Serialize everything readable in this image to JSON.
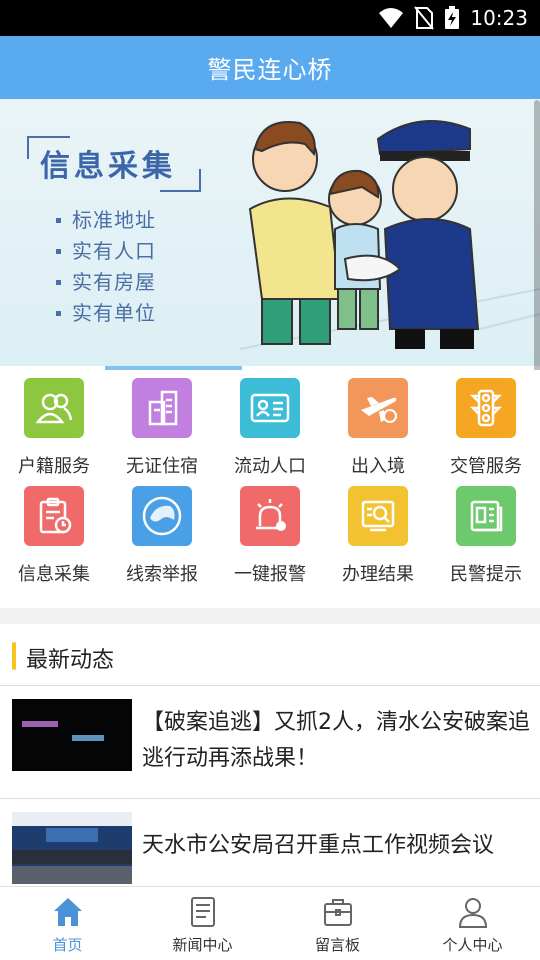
{
  "status_bar": {
    "time": "10:23",
    "icons": [
      "wifi-icon",
      "no-sim-icon",
      "battery-charging-icon"
    ]
  },
  "header": {
    "title": "警民连心桥",
    "color": "#5aaaf0"
  },
  "banner": {
    "title": "信息采集",
    "items": [
      "标准地址",
      "实有人口",
      "实有房屋",
      "实有单位"
    ]
  },
  "services": [
    {
      "label": "户籍服务",
      "icon": "household-icon",
      "color": "#8dc63f"
    },
    {
      "label": "无证住宿",
      "icon": "building-icon",
      "color": "#c17fe0"
    },
    {
      "label": "流动人口",
      "icon": "id-card-icon",
      "color": "#3dbcd8"
    },
    {
      "label": "出入境",
      "icon": "airplane-icon",
      "color": "#f39659"
    },
    {
      "label": "交管服务",
      "icon": "traffic-light-icon",
      "color": "#f5a623"
    },
    {
      "label": "信息采集",
      "icon": "clipboard-clock-icon",
      "color": "#f06a6a"
    },
    {
      "label": "线索举报",
      "icon": "eagle-icon",
      "color": "#4aa0e6"
    },
    {
      "label": "一键报警",
      "icon": "alarm-light-icon",
      "color": "#f06a6a"
    },
    {
      "label": "办理结果",
      "icon": "search-document-icon",
      "color": "#f2c230"
    },
    {
      "label": "民警提示",
      "icon": "notice-icon",
      "color": "#6cc96c"
    }
  ],
  "news": {
    "section_title": "最新动态",
    "items": [
      {
        "title": "【破案追逃】又抓2人，清水公安破案追逃行动再添战果！"
      },
      {
        "title": "天水市公安局召开重点工作视频会议"
      }
    ]
  },
  "bottom_nav": [
    {
      "label": "首页",
      "icon": "home-icon",
      "active": true
    },
    {
      "label": "新闻中心",
      "icon": "news-icon",
      "active": false
    },
    {
      "label": "留言板",
      "icon": "briefcase-icon",
      "active": false
    },
    {
      "label": "个人中心",
      "icon": "person-icon",
      "active": false
    }
  ]
}
